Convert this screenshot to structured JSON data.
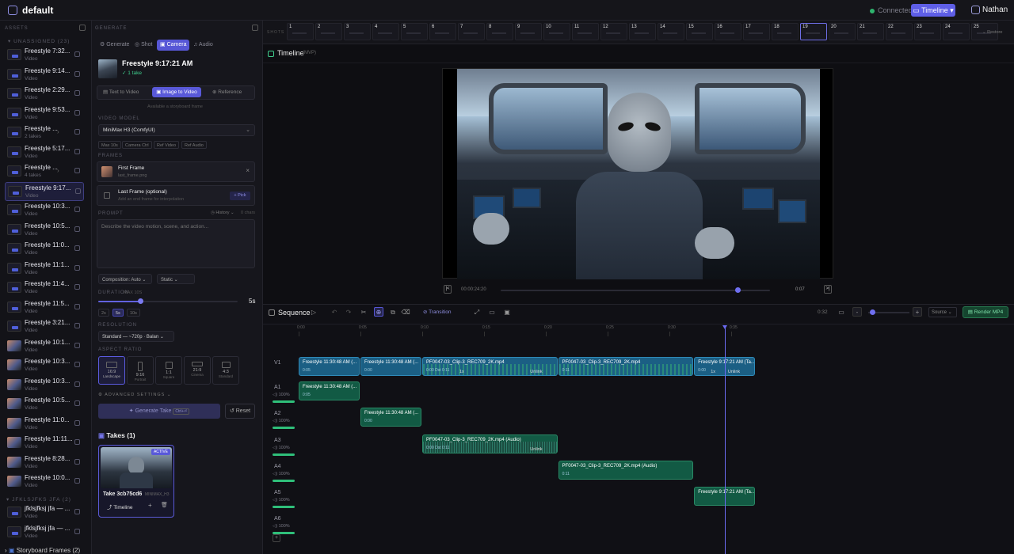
{
  "topbar": {
    "project": "default",
    "status": "Connected",
    "timeline_btn": "Timeline",
    "user": "Nathan"
  },
  "assets": {
    "header": "ASSETS",
    "group1": "UNASSIGNED (23)",
    "items": [
      {
        "name": "Freestyle 7:32...",
        "sub": "Video",
        "thumb": "vid"
      },
      {
        "name": "Freestyle 9:14...",
        "sub": "Video",
        "thumb": "vid"
      },
      {
        "name": "Freestyle 2:29...",
        "sub": "Video",
        "thumb": "vid"
      },
      {
        "name": "Freestyle 9:53...",
        "sub": "Video",
        "thumb": "vid"
      },
      {
        "name": "Freestyle ...",
        "sub": "2 takes",
        "thumb": "vid"
      },
      {
        "name": "Freestyle 5:17...",
        "sub": "Video",
        "thumb": "vid"
      },
      {
        "name": "Freestyle ...",
        "sub": "4 takes",
        "thumb": "vid"
      },
      {
        "name": "Freestyle 9:17...",
        "sub": "Video",
        "thumb": "vid"
      },
      {
        "name": "Freestyle 10:3...",
        "sub": "Video",
        "thumb": "vid"
      },
      {
        "name": "Freestyle 10:5...",
        "sub": "Video",
        "thumb": "vid"
      },
      {
        "name": "Freestyle 11:0...",
        "sub": "Video",
        "thumb": "vid"
      },
      {
        "name": "Freestyle 11:1...",
        "sub": "Video",
        "thumb": "vid"
      },
      {
        "name": "Freestyle 11:4...",
        "sub": "Video",
        "thumb": "vid"
      },
      {
        "name": "Freestyle 11:5...",
        "sub": "Video",
        "thumb": "vid"
      },
      {
        "name": "Freestyle 3:21...",
        "sub": "Video",
        "thumb": "vid"
      },
      {
        "name": "Freestyle 10:1...",
        "sub": "Video",
        "thumb": "img"
      },
      {
        "name": "Freestyle 10:3...",
        "sub": "Video",
        "thumb": "img"
      },
      {
        "name": "Freestyle 10:3...",
        "sub": "Video",
        "thumb": "img"
      },
      {
        "name": "Freestyle 10:5...",
        "sub": "Video",
        "thumb": "img"
      },
      {
        "name": "Freestyle 11:0...",
        "sub": "Video",
        "thumb": "img"
      },
      {
        "name": "Freestyle 11:11...",
        "sub": "Video",
        "thumb": "img"
      },
      {
        "name": "Freestyle 8:28...",
        "sub": "Video",
        "thumb": "img"
      },
      {
        "name": "Freestyle 10:0...",
        "sub": "Video",
        "thumb": "img"
      }
    ],
    "group2": "JFKLSJFKS JFA (2)",
    "group2_items": [
      {
        "name": "jfklsjfksj jfa — ...",
        "sub": "Video"
      },
      {
        "name": "jfklsjfksj jfa — ...",
        "sub": "Video"
      }
    ],
    "storyboard": "Storyboard Frames (2)"
  },
  "generator": {
    "header": "GENERATE",
    "tabs": [
      "Generate",
      "Shot",
      "Camera",
      "Audio"
    ],
    "title": "Freestyle 9:17:21 AM",
    "takes_count": "1 take",
    "modes": [
      "Text to Video",
      "Image to Video",
      "Reference"
    ],
    "hint": "Available a storyboard frame",
    "model_label": "VIDEO MODEL",
    "model_value": "MiniMax H3 (ComfyUI)",
    "model_tags": [
      "Max 10s",
      "Camera Ctrl",
      "Ref Video",
      "Ref Audio"
    ],
    "frames_label": "FRAMES",
    "first_frame": "First Frame",
    "first_frame_file": "last_frame.png",
    "last_frame": "Last Frame (optional)",
    "last_frame_hint": "Add an end frame for interpolation",
    "pick": "+ Pick",
    "prompt_label": "PROMPT",
    "history": "History",
    "chars": "0 chars",
    "prompt_placeholder": "Describe the video motion, scene, and action...",
    "composition": "Composition: Auto",
    "motion": "Static",
    "duration_label": "DURATION",
    "duration_max": "MAX 10S",
    "duration_value": "5s",
    "duration_fraction": 0.3,
    "duration_opts": [
      "2s",
      "5s",
      "10s"
    ],
    "resolution_label": "RESOLUTION",
    "resolution_value": "Standard — ~720p · Balan",
    "aspect_label": "ASPECT RATIO",
    "aspects": [
      {
        "r": "16:9",
        "n": "Landscape"
      },
      {
        "r": "9:16",
        "n": "Portrait"
      },
      {
        "r": "1:1",
        "n": "Square"
      },
      {
        "r": "21:9",
        "n": "Cinema"
      },
      {
        "r": "4:3",
        "n": "Standard"
      }
    ],
    "advanced": "ADVANCED SETTINGS",
    "generate_btn": "Generate Take",
    "generate_kbd": "Ctrl+⏎",
    "reset": "Reset",
    "takes_title": "Takes (1)",
    "take_badge": "ACTIVE",
    "take_name": "Take 3cb75cd6",
    "take_meta": "MINIMAX_H3",
    "take_timeline": "Timeline"
  },
  "strip": {
    "label": "SHOTS",
    "shots": [
      "1",
      "2",
      "3",
      "4",
      "5",
      "6",
      "7",
      "8",
      "9",
      "10",
      "11",
      "12",
      "13",
      "14",
      "15",
      "16",
      "17",
      "18",
      "19",
      "20",
      "21",
      "22",
      "23",
      "24",
      "25"
    ],
    "active": 19,
    "restore": "Restore"
  },
  "preview": {
    "title": "Timeline",
    "badge": "(MVP)",
    "timecode": "00:00:24:20",
    "duration": "0:07",
    "progress": 0.88
  },
  "sequence": {
    "title": "Sequence",
    "transition": "Transition",
    "zoom": "0:32",
    "source": "Source",
    "render": "Render MP4",
    "ticks": [
      "0:00",
      "0:05",
      "0:10",
      "0:15",
      "0:20",
      "0:25",
      "0:30",
      "0:35"
    ],
    "tracks": [
      {
        "name": "V1",
        "vol": ""
      },
      {
        "name": "A1",
        "vol": "100%"
      },
      {
        "name": "A2",
        "vol": "100%"
      },
      {
        "name": "A3",
        "vol": "100%"
      },
      {
        "name": "A4",
        "vol": "100%"
      },
      {
        "name": "A5",
        "vol": "100%"
      },
      {
        "name": "A6",
        "vol": "100%"
      }
    ],
    "clips": [
      {
        "track": 0,
        "kind": "v",
        "start": 0,
        "end": 5,
        "title": "Freestyle 11:30:48 AM (...",
        "sub": "0:05"
      },
      {
        "track": 0,
        "kind": "v",
        "start": 5,
        "end": 10,
        "title": "Freestyle 11:30:48 AM (...",
        "sub": "0:00"
      },
      {
        "track": 0,
        "kind": "v",
        "start": 10,
        "end": 21,
        "title": "PF0047-03_Clip-3_REC709_2K.mp4",
        "sub": "0:00 Dst 0:11",
        "speed": "1x",
        "unlink": "Unlink"
      },
      {
        "track": 0,
        "kind": "v",
        "start": 21,
        "end": 32,
        "title": "PF0047-03_Clip-3_REC709_2K.mp4",
        "sub": "0:11"
      },
      {
        "track": 0,
        "kind": "v",
        "start": 32,
        "end": 37,
        "title": "Freestyle 9:17:21 AM (Ta...",
        "sub": "0:00",
        "speed": "1x",
        "unlink": "Unlink"
      },
      {
        "track": 1,
        "kind": "a",
        "start": 0,
        "end": 5,
        "title": "Freestyle 11:30:48 AM (...",
        "sub": "0:05"
      },
      {
        "track": 2,
        "kind": "a",
        "start": 5,
        "end": 10,
        "title": "Freestyle 11:30:48 AM (...",
        "sub": "0:00"
      },
      {
        "track": 3,
        "kind": "a",
        "start": 10,
        "end": 21,
        "title": "PF0047-03_Clip-3_REC709_2K.mp4 (Audio)",
        "sub": "0:00 Dst 0:11",
        "unlink": "Unlink"
      },
      {
        "track": 4,
        "kind": "a",
        "start": 21,
        "end": 32,
        "title": "PF0047-03_Clip-3_REC709_2K.mp4 (Audio)",
        "sub": "0:11"
      },
      {
        "track": 5,
        "kind": "a",
        "start": 32,
        "end": 37,
        "title": "Freestyle 9:17:21 AM (Ta...",
        "sub": ""
      }
    ],
    "playhead": 34.5
  }
}
